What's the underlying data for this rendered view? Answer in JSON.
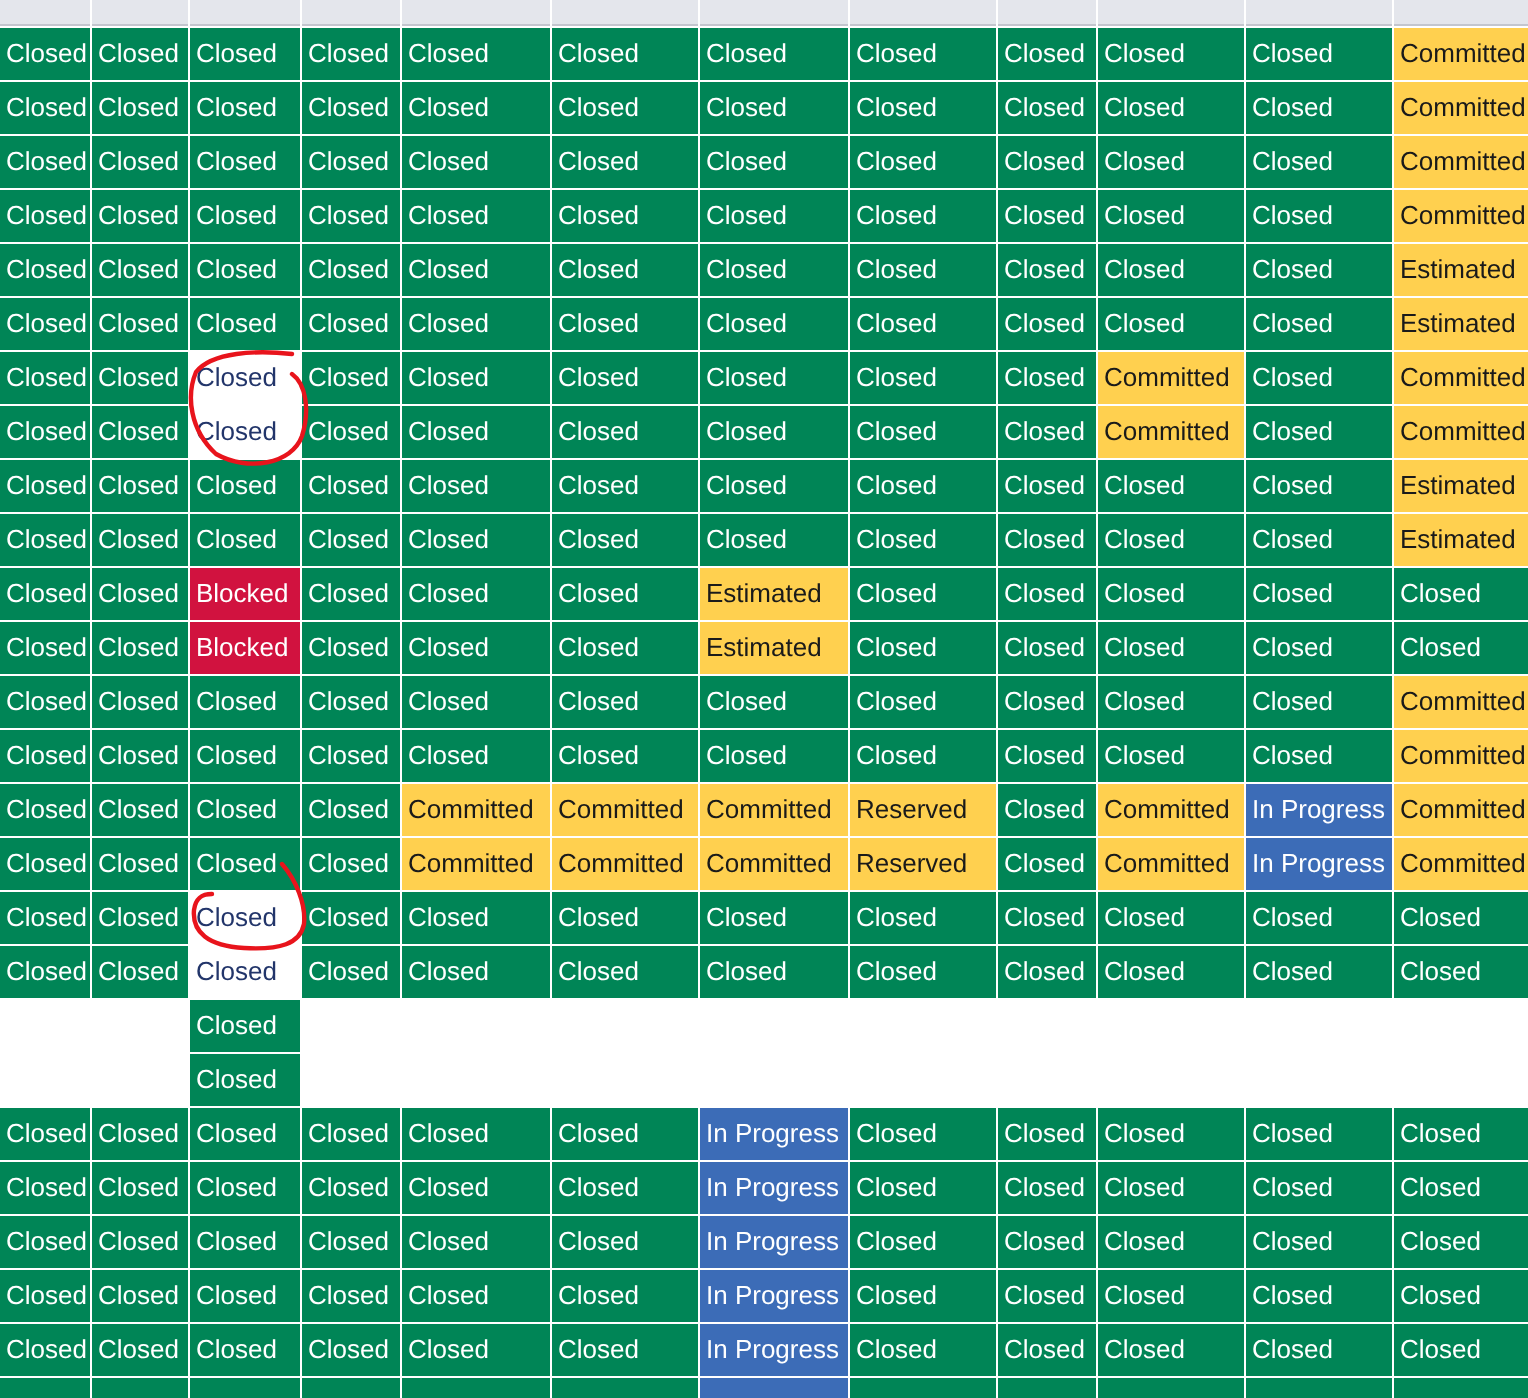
{
  "rows": [
    {
      "cells": [
        {
          "text": "Closed",
          "color": "#008556"
        },
        {
          "text": "Closed",
          "color": "#008556"
        },
        {
          "text": "Closed",
          "color": "#008556"
        },
        {
          "text": "Closed",
          "color": "#008556"
        },
        {
          "text": "Closed",
          "color": "#008556"
        },
        {
          "text": "Closed",
          "color": "#008556"
        },
        {
          "text": "Closed",
          "color": "#008556"
        },
        {
          "text": "Closed",
          "color": "#008556"
        },
        {
          "text": "Closed",
          "color": "#008556"
        },
        {
          "text": "Closed",
          "color": "#008556"
        },
        {
          "text": "Closed",
          "color": "#008556"
        },
        {
          "text": "Committed",
          "color": "#ffd04f"
        }
      ]
    },
    {
      "cells": [
        {
          "text": "Closed",
          "color": "#008556"
        },
        {
          "text": "Closed",
          "color": "#008556"
        },
        {
          "text": "Closed",
          "color": "#008556"
        },
        {
          "text": "Closed",
          "color": "#008556"
        },
        {
          "text": "Closed",
          "color": "#008556"
        },
        {
          "text": "Closed",
          "color": "#008556"
        },
        {
          "text": "Closed",
          "color": "#008556"
        },
        {
          "text": "Closed",
          "color": "#008556"
        },
        {
          "text": "Closed",
          "color": "#008556"
        },
        {
          "text": "Closed",
          "color": "#008556"
        },
        {
          "text": "Closed",
          "color": "#008556"
        },
        {
          "text": "Committed",
          "color": "#ffd04f"
        }
      ]
    },
    {
      "cells": [
        {
          "text": "Closed",
          "color": "#008556"
        },
        {
          "text": "Closed",
          "color": "#008556"
        },
        {
          "text": "Closed",
          "color": "#008556"
        },
        {
          "text": "Closed",
          "color": "#008556"
        },
        {
          "text": "Closed",
          "color": "#008556"
        },
        {
          "text": "Closed",
          "color": "#008556"
        },
        {
          "text": "Closed",
          "color": "#008556"
        },
        {
          "text": "Closed",
          "color": "#008556"
        },
        {
          "text": "Closed",
          "color": "#008556"
        },
        {
          "text": "Closed",
          "color": "#008556"
        },
        {
          "text": "Closed",
          "color": "#008556"
        },
        {
          "text": "Committed",
          "color": "#ffd04f"
        }
      ]
    },
    {
      "cells": [
        {
          "text": "Closed",
          "color": "#008556"
        },
        {
          "text": "Closed",
          "color": "#008556"
        },
        {
          "text": "Closed",
          "color": "#008556"
        },
        {
          "text": "Closed",
          "color": "#008556"
        },
        {
          "text": "Closed",
          "color": "#008556"
        },
        {
          "text": "Closed",
          "color": "#008556"
        },
        {
          "text": "Closed",
          "color": "#008556"
        },
        {
          "text": "Closed",
          "color": "#008556"
        },
        {
          "text": "Closed",
          "color": "#008556"
        },
        {
          "text": "Closed",
          "color": "#008556"
        },
        {
          "text": "Closed",
          "color": "#008556"
        },
        {
          "text": "Committed",
          "color": "#ffd04f"
        }
      ]
    },
    {
      "cells": [
        {
          "text": "Closed",
          "color": "#008556"
        },
        {
          "text": "Closed",
          "color": "#008556"
        },
        {
          "text": "Closed",
          "color": "#008556"
        },
        {
          "text": "Closed",
          "color": "#008556"
        },
        {
          "text": "Closed",
          "color": "#008556"
        },
        {
          "text": "Closed",
          "color": "#008556"
        },
        {
          "text": "Closed",
          "color": "#008556"
        },
        {
          "text": "Closed",
          "color": "#008556"
        },
        {
          "text": "Closed",
          "color": "#008556"
        },
        {
          "text": "Closed",
          "color": "#008556"
        },
        {
          "text": "Closed",
          "color": "#008556"
        },
        {
          "text": "Estimated",
          "color": "#ffd04f"
        }
      ]
    },
    {
      "cells": [
        {
          "text": "Closed",
          "color": "#008556"
        },
        {
          "text": "Closed",
          "color": "#008556"
        },
        {
          "text": "Closed",
          "color": "#008556"
        },
        {
          "text": "Closed",
          "color": "#008556"
        },
        {
          "text": "Closed",
          "color": "#008556"
        },
        {
          "text": "Closed",
          "color": "#008556"
        },
        {
          "text": "Closed",
          "color": "#008556"
        },
        {
          "text": "Closed",
          "color": "#008556"
        },
        {
          "text": "Closed",
          "color": "#008556"
        },
        {
          "text": "Closed",
          "color": "#008556"
        },
        {
          "text": "Closed",
          "color": "#008556"
        },
        {
          "text": "Estimated",
          "color": "#ffd04f"
        }
      ]
    },
    {
      "cells": [
        {
          "text": "Closed",
          "color": "#008556"
        },
        {
          "text": "Closed",
          "color": "#008556"
        },
        {
          "text": "Closed",
          "color": "#ffffff"
        },
        {
          "text": "Closed",
          "color": "#008556"
        },
        {
          "text": "Closed",
          "color": "#008556"
        },
        {
          "text": "Closed",
          "color": "#008556"
        },
        {
          "text": "Closed",
          "color": "#008556"
        },
        {
          "text": "Closed",
          "color": "#008556"
        },
        {
          "text": "Closed",
          "color": "#008556"
        },
        {
          "text": "Committed",
          "color": "#ffd04f"
        },
        {
          "text": "Closed",
          "color": "#008556"
        },
        {
          "text": "Committed",
          "color": "#ffd04f"
        }
      ]
    },
    {
      "cells": [
        {
          "text": "Closed",
          "color": "#008556"
        },
        {
          "text": "Closed",
          "color": "#008556"
        },
        {
          "text": "Closed",
          "color": "#ffffff"
        },
        {
          "text": "Closed",
          "color": "#008556"
        },
        {
          "text": "Closed",
          "color": "#008556"
        },
        {
          "text": "Closed",
          "color": "#008556"
        },
        {
          "text": "Closed",
          "color": "#008556"
        },
        {
          "text": "Closed",
          "color": "#008556"
        },
        {
          "text": "Closed",
          "color": "#008556"
        },
        {
          "text": "Committed",
          "color": "#ffd04f"
        },
        {
          "text": "Closed",
          "color": "#008556"
        },
        {
          "text": "Committed",
          "color": "#ffd04f"
        }
      ]
    },
    {
      "cells": [
        {
          "text": "Closed",
          "color": "#008556"
        },
        {
          "text": "Closed",
          "color": "#008556"
        },
        {
          "text": "Closed",
          "color": "#008556"
        },
        {
          "text": "Closed",
          "color": "#008556"
        },
        {
          "text": "Closed",
          "color": "#008556"
        },
        {
          "text": "Closed",
          "color": "#008556"
        },
        {
          "text": "Closed",
          "color": "#008556"
        },
        {
          "text": "Closed",
          "color": "#008556"
        },
        {
          "text": "Closed",
          "color": "#008556"
        },
        {
          "text": "Closed",
          "color": "#008556"
        },
        {
          "text": "Closed",
          "color": "#008556"
        },
        {
          "text": "Estimated",
          "color": "#ffd04f"
        }
      ]
    },
    {
      "cells": [
        {
          "text": "Closed",
          "color": "#008556"
        },
        {
          "text": "Closed",
          "color": "#008556"
        },
        {
          "text": "Closed",
          "color": "#008556"
        },
        {
          "text": "Closed",
          "color": "#008556"
        },
        {
          "text": "Closed",
          "color": "#008556"
        },
        {
          "text": "Closed",
          "color": "#008556"
        },
        {
          "text": "Closed",
          "color": "#008556"
        },
        {
          "text": "Closed",
          "color": "#008556"
        },
        {
          "text": "Closed",
          "color": "#008556"
        },
        {
          "text": "Closed",
          "color": "#008556"
        },
        {
          "text": "Closed",
          "color": "#008556"
        },
        {
          "text": "Estimated",
          "color": "#ffd04f"
        }
      ]
    },
    {
      "cells": [
        {
          "text": "Closed",
          "color": "#008556"
        },
        {
          "text": "Closed",
          "color": "#008556"
        },
        {
          "text": "Blocked",
          "color": "#d1123f"
        },
        {
          "text": "Closed",
          "color": "#008556"
        },
        {
          "text": "Closed",
          "color": "#008556"
        },
        {
          "text": "Closed",
          "color": "#008556"
        },
        {
          "text": "Estimated",
          "color": "#ffd04f"
        },
        {
          "text": "Closed",
          "color": "#008556"
        },
        {
          "text": "Closed",
          "color": "#008556"
        },
        {
          "text": "Closed",
          "color": "#008556"
        },
        {
          "text": "Closed",
          "color": "#008556"
        },
        {
          "text": "Closed",
          "color": "#008556"
        }
      ]
    },
    {
      "cells": [
        {
          "text": "Closed",
          "color": "#008556"
        },
        {
          "text": "Closed",
          "color": "#008556"
        },
        {
          "text": "Blocked",
          "color": "#d1123f"
        },
        {
          "text": "Closed",
          "color": "#008556"
        },
        {
          "text": "Closed",
          "color": "#008556"
        },
        {
          "text": "Closed",
          "color": "#008556"
        },
        {
          "text": "Estimated",
          "color": "#ffd04f"
        },
        {
          "text": "Closed",
          "color": "#008556"
        },
        {
          "text": "Closed",
          "color": "#008556"
        },
        {
          "text": "Closed",
          "color": "#008556"
        },
        {
          "text": "Closed",
          "color": "#008556"
        },
        {
          "text": "Closed",
          "color": "#008556"
        }
      ]
    },
    {
      "cells": [
        {
          "text": "Closed",
          "color": "#008556"
        },
        {
          "text": "Closed",
          "color": "#008556"
        },
        {
          "text": "Closed",
          "color": "#008556"
        },
        {
          "text": "Closed",
          "color": "#008556"
        },
        {
          "text": "Closed",
          "color": "#008556"
        },
        {
          "text": "Closed",
          "color": "#008556"
        },
        {
          "text": "Closed",
          "color": "#008556"
        },
        {
          "text": "Closed",
          "color": "#008556"
        },
        {
          "text": "Closed",
          "color": "#008556"
        },
        {
          "text": "Closed",
          "color": "#008556"
        },
        {
          "text": "Closed",
          "color": "#008556"
        },
        {
          "text": "Committed",
          "color": "#ffd04f"
        }
      ]
    },
    {
      "cells": [
        {
          "text": "Closed",
          "color": "#008556"
        },
        {
          "text": "Closed",
          "color": "#008556"
        },
        {
          "text": "Closed",
          "color": "#008556"
        },
        {
          "text": "Closed",
          "color": "#008556"
        },
        {
          "text": "Closed",
          "color": "#008556"
        },
        {
          "text": "Closed",
          "color": "#008556"
        },
        {
          "text": "Closed",
          "color": "#008556"
        },
        {
          "text": "Closed",
          "color": "#008556"
        },
        {
          "text": "Closed",
          "color": "#008556"
        },
        {
          "text": "Closed",
          "color": "#008556"
        },
        {
          "text": "Closed",
          "color": "#008556"
        },
        {
          "text": "Committed",
          "color": "#ffd04f"
        }
      ]
    },
    {
      "cells": [
        {
          "text": "Closed",
          "color": "#008556"
        },
        {
          "text": "Closed",
          "color": "#008556"
        },
        {
          "text": "Closed",
          "color": "#008556"
        },
        {
          "text": "Closed",
          "color": "#008556"
        },
        {
          "text": "Committed",
          "color": "#ffd04f"
        },
        {
          "text": "Committed",
          "color": "#ffd04f"
        },
        {
          "text": "Committed",
          "color": "#ffd04f"
        },
        {
          "text": "Reserved",
          "color": "#ffd04f"
        },
        {
          "text": "Closed",
          "color": "#008556"
        },
        {
          "text": "Committed",
          "color": "#ffd04f"
        },
        {
          "text": "In Progress",
          "color": "#3c6cb7"
        },
        {
          "text": "Committed",
          "color": "#ffd04f"
        }
      ]
    },
    {
      "cells": [
        {
          "text": "Closed",
          "color": "#008556"
        },
        {
          "text": "Closed",
          "color": "#008556"
        },
        {
          "text": "Closed",
          "color": "#008556"
        },
        {
          "text": "Closed",
          "color": "#008556"
        },
        {
          "text": "Committed",
          "color": "#ffd04f"
        },
        {
          "text": "Committed",
          "color": "#ffd04f"
        },
        {
          "text": "Committed",
          "color": "#ffd04f"
        },
        {
          "text": "Reserved",
          "color": "#ffd04f"
        },
        {
          "text": "Closed",
          "color": "#008556"
        },
        {
          "text": "Committed",
          "color": "#ffd04f"
        },
        {
          "text": "In Progress",
          "color": "#3c6cb7"
        },
        {
          "text": "Committed",
          "color": "#ffd04f"
        }
      ]
    },
    {
      "cells": [
        {
          "text": "Closed",
          "color": "#008556"
        },
        {
          "text": "Closed",
          "color": "#008556"
        },
        {
          "text": "Closed",
          "color": "#ffffff"
        },
        {
          "text": "Closed",
          "color": "#008556"
        },
        {
          "text": "Closed",
          "color": "#008556"
        },
        {
          "text": "Closed",
          "color": "#008556"
        },
        {
          "text": "Closed",
          "color": "#008556"
        },
        {
          "text": "Closed",
          "color": "#008556"
        },
        {
          "text": "Closed",
          "color": "#008556"
        },
        {
          "text": "Closed",
          "color": "#008556"
        },
        {
          "text": "Closed",
          "color": "#008556"
        },
        {
          "text": "Closed",
          "color": "#008556"
        }
      ]
    },
    {
      "cells": [
        {
          "text": "Closed",
          "color": "#008556"
        },
        {
          "text": "Closed",
          "color": "#008556"
        },
        {
          "text": "Closed",
          "color": "#ffffff"
        },
        {
          "text": "Closed",
          "color": "#008556"
        },
        {
          "text": "Closed",
          "color": "#008556"
        },
        {
          "text": "Closed",
          "color": "#008556"
        },
        {
          "text": "Closed",
          "color": "#008556"
        },
        {
          "text": "Closed",
          "color": "#008556"
        },
        {
          "text": "Closed",
          "color": "#008556"
        },
        {
          "text": "Closed",
          "color": "#008556"
        },
        {
          "text": "Closed",
          "color": "#008556"
        },
        {
          "text": "Closed",
          "color": "#008556"
        }
      ]
    },
    {
      "cells": [
        {},
        {},
        {
          "text": "Closed",
          "color": "#008556"
        },
        {},
        {},
        {},
        {},
        {},
        {},
        {},
        {},
        {}
      ]
    },
    {
      "cells": [
        {},
        {},
        {
          "text": "Closed",
          "color": "#008556"
        },
        {},
        {},
        {},
        {},
        {},
        {},
        {},
        {},
        {}
      ]
    },
    {
      "cells": [
        {
          "text": "Closed",
          "color": "#008556"
        },
        {
          "text": "Closed",
          "color": "#008556"
        },
        {
          "text": "Closed",
          "color": "#008556"
        },
        {
          "text": "Closed",
          "color": "#008556"
        },
        {
          "text": "Closed",
          "color": "#008556"
        },
        {
          "text": "Closed",
          "color": "#008556"
        },
        {
          "text": "In Progress",
          "color": "#3c6cb7"
        },
        {
          "text": "Closed",
          "color": "#008556"
        },
        {
          "text": "Closed",
          "color": "#008556"
        },
        {
          "text": "Closed",
          "color": "#008556"
        },
        {
          "text": "Closed",
          "color": "#008556"
        },
        {
          "text": "Closed",
          "color": "#008556"
        }
      ]
    },
    {
      "cells": [
        {
          "text": "Closed",
          "color": "#008556"
        },
        {
          "text": "Closed",
          "color": "#008556"
        },
        {
          "text": "Closed",
          "color": "#008556"
        },
        {
          "text": "Closed",
          "color": "#008556"
        },
        {
          "text": "Closed",
          "color": "#008556"
        },
        {
          "text": "Closed",
          "color": "#008556"
        },
        {
          "text": "In Progress",
          "color": "#3c6cb7"
        },
        {
          "text": "Closed",
          "color": "#008556"
        },
        {
          "text": "Closed",
          "color": "#008556"
        },
        {
          "text": "Closed",
          "color": "#008556"
        },
        {
          "text": "Closed",
          "color": "#008556"
        },
        {
          "text": "Closed",
          "color": "#008556"
        }
      ]
    },
    {
      "cells": [
        {
          "text": "Closed",
          "color": "#008556"
        },
        {
          "text": "Closed",
          "color": "#008556"
        },
        {
          "text": "Closed",
          "color": "#008556"
        },
        {
          "text": "Closed",
          "color": "#008556"
        },
        {
          "text": "Closed",
          "color": "#008556"
        },
        {
          "text": "Closed",
          "color": "#008556"
        },
        {
          "text": "In Progress",
          "color": "#3c6cb7"
        },
        {
          "text": "Closed",
          "color": "#008556"
        },
        {
          "text": "Closed",
          "color": "#008556"
        },
        {
          "text": "Closed",
          "color": "#008556"
        },
        {
          "text": "Closed",
          "color": "#008556"
        },
        {
          "text": "Closed",
          "color": "#008556"
        }
      ]
    },
    {
      "cells": [
        {
          "text": "Closed",
          "color": "#008556"
        },
        {
          "text": "Closed",
          "color": "#008556"
        },
        {
          "text": "Closed",
          "color": "#008556"
        },
        {
          "text": "Closed",
          "color": "#008556"
        },
        {
          "text": "Closed",
          "color": "#008556"
        },
        {
          "text": "Closed",
          "color": "#008556"
        },
        {
          "text": "In Progress",
          "color": "#3c6cb7"
        },
        {
          "text": "Closed",
          "color": "#008556"
        },
        {
          "text": "Closed",
          "color": "#008556"
        },
        {
          "text": "Closed",
          "color": "#008556"
        },
        {
          "text": "Closed",
          "color": "#008556"
        },
        {
          "text": "Closed",
          "color": "#008556"
        }
      ]
    },
    {
      "cells": [
        {
          "text": "Closed",
          "color": "#008556"
        },
        {
          "text": "Closed",
          "color": "#008556"
        },
        {
          "text": "Closed",
          "color": "#008556"
        },
        {
          "text": "Closed",
          "color": "#008556"
        },
        {
          "text": "Closed",
          "color": "#008556"
        },
        {
          "text": "Closed",
          "color": "#008556"
        },
        {
          "text": "In Progress",
          "color": "#3c6cb7"
        },
        {
          "text": "Closed",
          "color": "#008556"
        },
        {
          "text": "Closed",
          "color": "#008556"
        },
        {
          "text": "Closed",
          "color": "#008556"
        },
        {
          "text": "Closed",
          "color": "#008556"
        },
        {
          "text": "Closed",
          "color": "#008556"
        }
      ]
    },
    {
      "cells": [
        {
          "color": "#008556"
        },
        {
          "color": "#008556"
        },
        {
          "color": "#008556"
        },
        {
          "color": "#008556"
        },
        {
          "color": "#008556"
        },
        {
          "color": "#008556"
        },
        {
          "color": "#3c6cb7"
        },
        {
          "color": "#008556"
        },
        {
          "color": "#008556"
        },
        {
          "color": "#008556"
        },
        {
          "color": "#008556"
        },
        {
          "color": "#008556"
        }
      ]
    }
  ]
}
